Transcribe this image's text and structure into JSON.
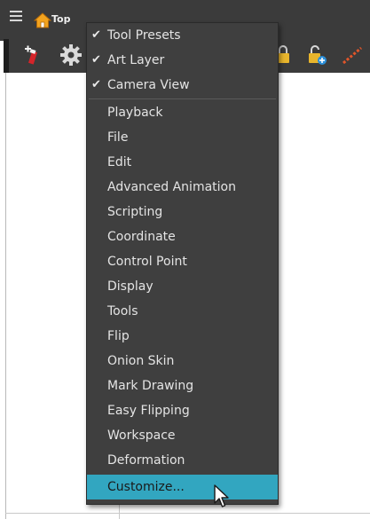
{
  "breadcrumb": {
    "label": "Top",
    "icon": "home-icon"
  },
  "toolbar": {
    "icons": [
      "add-peg-icon",
      "gear-icon",
      "lock-icon",
      "unlock-icon",
      "onion-skin-icon"
    ]
  },
  "menu": {
    "checked_items": [
      {
        "label": "Tool Presets",
        "checked": true
      },
      {
        "label": "Art Layer",
        "checked": true
      },
      {
        "label": "Camera View",
        "checked": true
      }
    ],
    "items": [
      {
        "label": "Playback"
      },
      {
        "label": "File"
      },
      {
        "label": "Edit"
      },
      {
        "label": "Advanced Animation"
      },
      {
        "label": "Scripting"
      },
      {
        "label": "Coordinate"
      },
      {
        "label": "Control Point"
      },
      {
        "label": "Display"
      },
      {
        "label": "Tools"
      },
      {
        "label": "Flip"
      },
      {
        "label": "Onion Skin"
      },
      {
        "label": "Mark Drawing"
      },
      {
        "label": "Easy Flipping"
      },
      {
        "label": "Workspace"
      },
      {
        "label": "Deformation"
      },
      {
        "label": "Customize..."
      }
    ],
    "highlighted_item": "Customize...",
    "check_glyph": "✔"
  },
  "colors": {
    "menu_bg": "#3f3f3f",
    "highlight": "#32a6c0",
    "toolbar_bg": "#3b3b3b"
  }
}
